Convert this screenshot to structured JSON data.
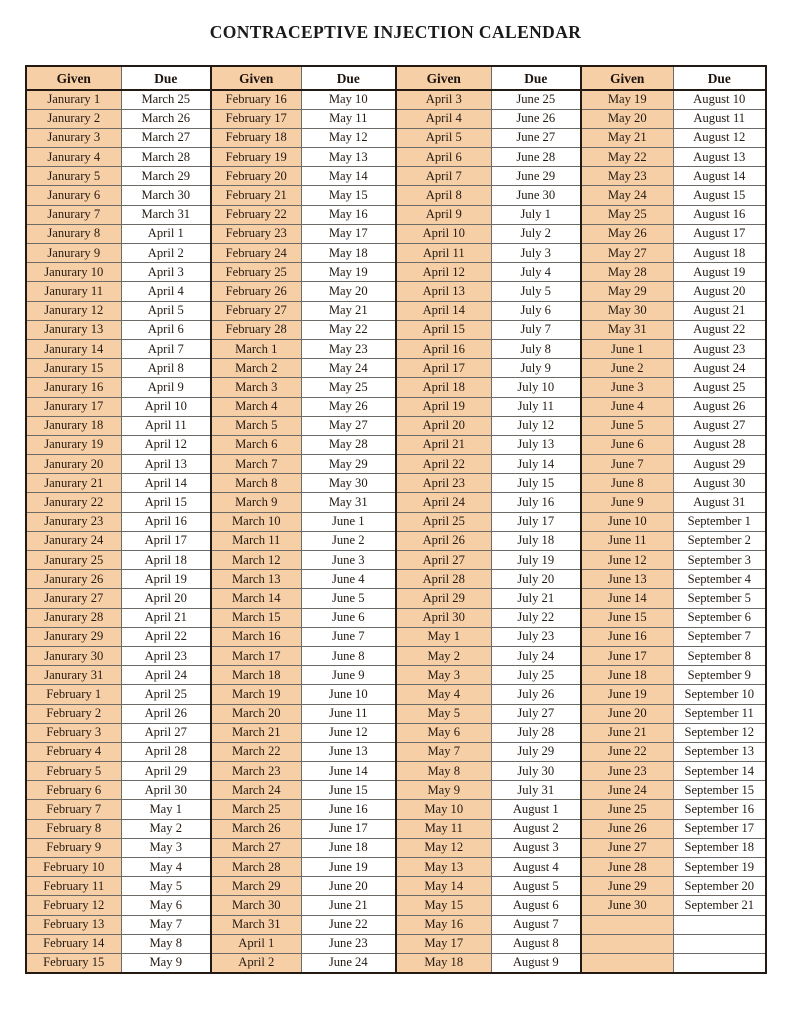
{
  "document": {
    "title": "CONTRACEPTIVE INJECTION CALENDAR"
  },
  "colors": {
    "given_cell_bg": "#F7CFA6",
    "due_cell_bg": "#FFFFFF",
    "outer_border": "#231A14",
    "inner_border": "#6E6A66",
    "text": "#241A12",
    "page_bg": "#FFFFFF"
  },
  "table": {
    "headers": [
      "Given",
      "Due",
      "Given",
      "Due",
      "Given",
      "Due",
      "Given",
      "Due"
    ],
    "row_count": 46,
    "rows": [
      [
        "Janurary 1",
        "March 25",
        "February 16",
        "May 10",
        "April 3",
        "June 25",
        "May 19",
        "August 10"
      ],
      [
        "Janurary 2",
        "March 26",
        "February 17",
        "May 11",
        "April 4",
        "June 26",
        "May 20",
        "August 11"
      ],
      [
        "Janurary 3",
        "March 27",
        "February 18",
        "May 12",
        "April 5",
        "June 27",
        "May 21",
        "August 12"
      ],
      [
        "Janurary 4",
        "March 28",
        "February 19",
        "May 13",
        "April 6",
        "June 28",
        "May 22",
        "August 13"
      ],
      [
        "Janurary 5",
        "March 29",
        "February 20",
        "May 14",
        "April 7",
        "June 29",
        "May 23",
        "August 14"
      ],
      [
        "Janurary 6",
        "March 30",
        "February 21",
        "May 15",
        "April 8",
        "June 30",
        "May 24",
        "August 15"
      ],
      [
        "Janurary 7",
        "March 31",
        "February 22",
        "May 16",
        "April 9",
        "July 1",
        "May 25",
        "August 16"
      ],
      [
        "Janurary 8",
        "April 1",
        "February 23",
        "May 17",
        "April 10",
        "July 2",
        "May 26",
        "August 17"
      ],
      [
        "Janurary 9",
        "April 2",
        "February 24",
        "May 18",
        "April 11",
        "July 3",
        "May 27",
        "August 18"
      ],
      [
        "Janurary 10",
        "April 3",
        "February 25",
        "May 19",
        "April 12",
        "July 4",
        "May 28",
        "August 19"
      ],
      [
        "Janurary 11",
        "April 4",
        "February 26",
        "May 20",
        "April 13",
        "July 5",
        "May 29",
        "August 20"
      ],
      [
        "Janurary 12",
        "April 5",
        "February 27",
        "May 21",
        "April 14",
        "July 6",
        "May 30",
        "August 21"
      ],
      [
        "Janurary 13",
        "April 6",
        "February 28",
        "May 22",
        "April 15",
        "July 7",
        "May 31",
        "August 22"
      ],
      [
        "Janurary 14",
        "April 7",
        "March 1",
        "May 23",
        "April 16",
        "July 8",
        "June 1",
        "August 23"
      ],
      [
        "Janurary 15",
        "April 8",
        "March 2",
        "May 24",
        "April 17",
        "July 9",
        "June 2",
        "August 24"
      ],
      [
        "Janurary 16",
        "April 9",
        "March 3",
        "May 25",
        "April 18",
        "July 10",
        "June 3",
        "August 25"
      ],
      [
        "Janurary 17",
        "April 10",
        "March 4",
        "May 26",
        "April 19",
        "July 11",
        "June 4",
        "August 26"
      ],
      [
        "Janurary 18",
        "April 11",
        "March 5",
        "May 27",
        "April 20",
        "July 12",
        "June 5",
        "August 27"
      ],
      [
        "Janurary 19",
        "April 12",
        "March 6",
        "May 28",
        "April 21",
        "July 13",
        "June 6",
        "August 28"
      ],
      [
        "Janurary 20",
        "April 13",
        "March 7",
        "May 29",
        "April 22",
        "July 14",
        "June 7",
        "August 29"
      ],
      [
        "Janurary 21",
        "April 14",
        "March 8",
        "May 30",
        "April 23",
        "July 15",
        "June 8",
        "August 30"
      ],
      [
        "Janurary 22",
        "April 15",
        "March 9",
        "May 31",
        "April 24",
        "July 16",
        "June 9",
        "August 31"
      ],
      [
        "Janurary 23",
        "April 16",
        "March 10",
        "June 1",
        "April 25",
        "July 17",
        "June 10",
        "September 1"
      ],
      [
        "Janurary 24",
        "April 17",
        "March 11",
        "June 2",
        "April 26",
        "July 18",
        "June 11",
        "September 2"
      ],
      [
        "Janurary 25",
        "April 18",
        "March 12",
        "June 3",
        "April 27",
        "July 19",
        "June 12",
        "September 3"
      ],
      [
        "Janurary 26",
        "April 19",
        "March 13",
        "June 4",
        "April 28",
        "July 20",
        "June 13",
        "September 4"
      ],
      [
        "Janurary 27",
        "April 20",
        "March 14",
        "June 5",
        "April 29",
        "July 21",
        "June 14",
        "September 5"
      ],
      [
        "Janurary 28",
        "April 21",
        "March 15",
        "June 6",
        "April 30",
        "July 22",
        "June 15",
        "September 6"
      ],
      [
        "Janurary 29",
        "April 22",
        "March 16",
        "June 7",
        "May 1",
        "July 23",
        "June 16",
        "September 7"
      ],
      [
        "Janurary 30",
        "April 23",
        "March 17",
        "June 8",
        "May 2",
        "July 24",
        "June 17",
        "September 8"
      ],
      [
        "Janurary 31",
        "April 24",
        "March 18",
        "June 9",
        "May 3",
        "July 25",
        "June 18",
        "September 9"
      ],
      [
        "February 1",
        "April 25",
        "March 19",
        "June 10",
        "May 4",
        "July 26",
        "June 19",
        "September 10"
      ],
      [
        "February 2",
        "April 26",
        "March 20",
        "June 11",
        "May 5",
        "July 27",
        "June 20",
        "September 11"
      ],
      [
        "February 3",
        "April 27",
        "March 21",
        "June 12",
        "May 6",
        "July 28",
        "June 21",
        "September 12"
      ],
      [
        "February 4",
        "April 28",
        "March 22",
        "June 13",
        "May 7",
        "July 29",
        "June 22",
        "September 13"
      ],
      [
        "February 5",
        "April 29",
        "March 23",
        "June 14",
        "May 8",
        "July 30",
        "June 23",
        "September 14"
      ],
      [
        "February 6",
        "April 30",
        "March 24",
        "June 15",
        "May 9",
        "July 31",
        "June 24",
        "September 15"
      ],
      [
        "February 7",
        "May 1",
        "March 25",
        "June 16",
        "May 10",
        "August 1",
        "June 25",
        "September 16"
      ],
      [
        "February 8",
        "May 2",
        "March 26",
        "June 17",
        "May 11",
        "August 2",
        "June 26",
        "September 17"
      ],
      [
        "February 9",
        "May 3",
        "March 27",
        "June 18",
        "May 12",
        "August 3",
        "June 27",
        "September 18"
      ],
      [
        "February 10",
        "May 4",
        "March 28",
        "June 19",
        "May 13",
        "August 4",
        "June 28",
        "September 19"
      ],
      [
        "February 11",
        "May 5",
        "March 29",
        "June 20",
        "May 14",
        "August 5",
        "June 29",
        "September 20"
      ],
      [
        "February 12",
        "May 6",
        "March 30",
        "June 21",
        "May 15",
        "August 6",
        "June 30",
        "September 21"
      ],
      [
        "February 13",
        "May 7",
        "March 31",
        "June 22",
        "May 16",
        "August 7",
        "",
        ""
      ],
      [
        "February 14",
        "May 8",
        "April 1",
        "June 23",
        "May 17",
        "August 8",
        "",
        ""
      ],
      [
        "February 15",
        "May 9",
        "April 2",
        "June 24",
        "May 18",
        "August 9",
        "",
        ""
      ]
    ]
  }
}
